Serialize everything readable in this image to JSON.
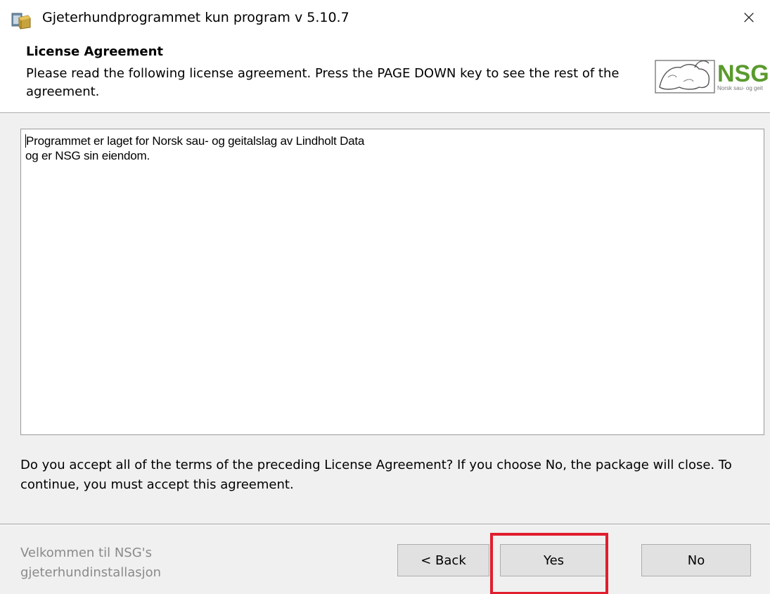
{
  "window": {
    "title": "Gjeterhundprogrammet kun program v 5.10.7",
    "close_glyph": "×",
    "app_icon": "installer-package-icon"
  },
  "header": {
    "title": "License Agreement",
    "description": "Please read the following license agreement. Press the PAGE DOWN key to see the rest of the agreement.",
    "logo": {
      "text": "NSG",
      "subtext": "Norsk sau- og geit",
      "icon": "sheep-logo-icon"
    }
  },
  "license": {
    "lines": [
      "Programmet er laget for Norsk sau- og geitalslag av Lindholt Data",
      "og er NSG sin eiendom."
    ]
  },
  "question": "Do you accept all of the terms of the preceding License Agreement? If you choose No, the package will close. To continue, you must accept this agreement.",
  "footer": {
    "brand_text": "Velkommen til NSG's gjeterhundinstallasjon"
  },
  "buttons": {
    "back": "< Back",
    "yes": "Yes",
    "no": "No"
  },
  "colors": {
    "highlight": "#e01e2e",
    "logo_green": "#5a9a2e",
    "dialog_bg": "#f0f0f0"
  }
}
